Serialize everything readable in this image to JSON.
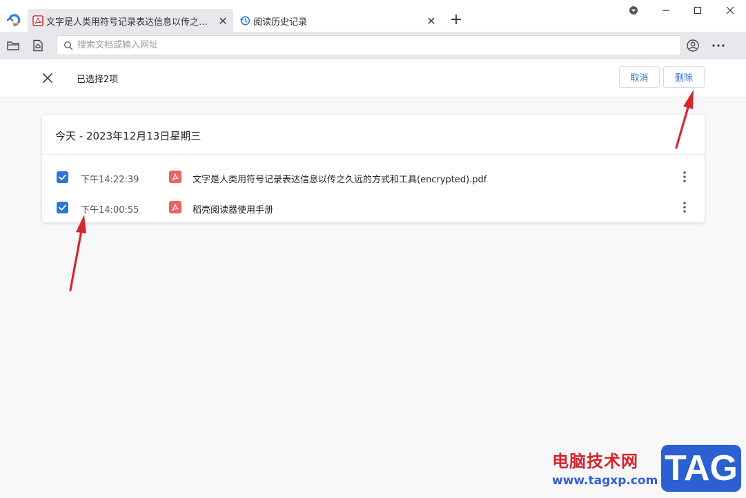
{
  "tabs": [
    {
      "title": "文字是人类用符号记录表达信息以传之久远...",
      "icon": "pdf-icon",
      "active": true
    },
    {
      "title": "阅读历史记录",
      "icon": "history-icon",
      "active": false
    }
  ],
  "new_tab_label": "+",
  "window_controls": [
    "dropdown-icon",
    "minimize-icon",
    "maximize-icon",
    "close-icon"
  ],
  "address_bar": {
    "placeholder": "搜索文档或输入网址",
    "value": ""
  },
  "selection": {
    "count_label": "已选择2项",
    "cancel_label": "取消",
    "delete_label": "删除"
  },
  "history": {
    "date_header": "今天 - 2023年12月13日星期三",
    "items": [
      {
        "time": "下午14:22:39",
        "name": "文字是人类用符号记录表达信息以传之久远的方式和工具(encrypted).pdf",
        "checked": true
      },
      {
        "time": "下午14:00:55",
        "name": "稻壳阅读器使用手册",
        "checked": true
      }
    ]
  },
  "watermark": {
    "site_name": "电脑技术网",
    "url": "www.tagxp.com",
    "tag": "TAG"
  },
  "colors": {
    "accent": "#2e74d9",
    "pdf": "#f1625a",
    "arrow": "#d9262a"
  }
}
